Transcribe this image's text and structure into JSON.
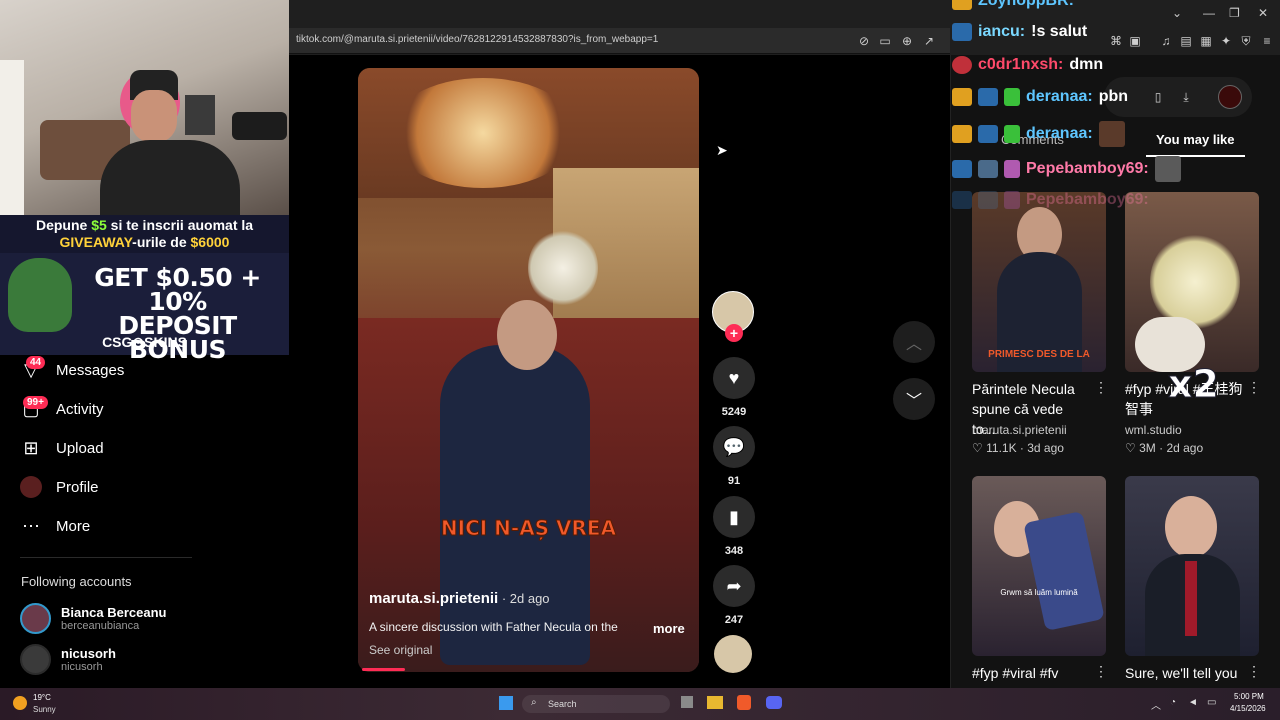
{
  "browser": {
    "url": "tiktok.com/@maruta.si.prietenii/video/7628122914532887830?is_from_webapp=1"
  },
  "promo": {
    "line1_prefix": "Depune ",
    "line1_amount": "$5",
    "line1_suffix": " si te inscrii auomat la",
    "line2_prefix": "GIVEAWAY",
    "line2_mid": "-urile de ",
    "line2_amount": "$6000",
    "bonus_line1": "GET $0.50 + 10%",
    "bonus_line2": "DEPOSIT BONUS",
    "brand": "CSG⊙SKINS"
  },
  "nav": {
    "items": [
      {
        "label": "Messages",
        "badge": "44",
        "icon": "paper-plane-icon"
      },
      {
        "label": "Activity",
        "badge": "99+",
        "icon": "inbox-icon"
      },
      {
        "label": "Upload",
        "icon": "plus-square-icon"
      },
      {
        "label": "Profile",
        "icon": "avatar-icon"
      },
      {
        "label": "More",
        "icon": "ellipsis-icon"
      }
    ],
    "following_title": "Following accounts",
    "following": [
      {
        "name": "Bianca Berceanu",
        "handle": "berceanubianca"
      },
      {
        "name": "nicusorh",
        "handle": "nicusorh"
      }
    ]
  },
  "video": {
    "caption": "NICI N-AȘ VREA",
    "author": "maruta.si.prietenii",
    "age": " · 2d ago",
    "description": "A sincere discussion with Father Necula on the",
    "more": "more",
    "see_original": "See original",
    "progress": 0.13,
    "likes": "5249",
    "comments": "91",
    "saves": "348",
    "shares": "247"
  },
  "right_panel": {
    "tab_comments": "Comments",
    "tab_may_like": "You may like",
    "cards": [
      {
        "title": "Părintele Necula spune că vede to...",
        "author": "maruta.si.prietenii",
        "likes": "11.1K",
        "age": "3d ago",
        "overlay": "PRIMESC DES DE LA"
      },
      {
        "title": "#fyp #viral #王桂狗智事",
        "author": "wml.studio",
        "likes": "3M",
        "age": "2d ago",
        "overlay": "x2"
      },
      {
        "title": "#fyp #viral #fv",
        "author": "",
        "likes": "",
        "age": "",
        "overlay": "Grwm să luăm lumină"
      },
      {
        "title": "Sure, we'll tell you",
        "author": "",
        "likes": "",
        "age": "",
        "overlay": ""
      }
    ]
  },
  "chat": [
    {
      "name": "ZoyhoppBR:",
      "msg": "",
      "color": "#5ec6ff"
    },
    {
      "name": "iancu:",
      "msg": "!s salut",
      "color": "#7ad8ff"
    },
    {
      "name": "c0dr1nxsh:",
      "msg": "dmn",
      "color": "#ff4a6a"
    },
    {
      "name": "deranaa:",
      "msg": "pbn",
      "color": "#5ec6ff"
    },
    {
      "name": "deranaa:",
      "msg": "",
      "color": "#5ec6ff"
    },
    {
      "name": "Pepebamboy69:",
      "msg": "",
      "color": "#ff7aa8"
    },
    {
      "name": "Pepebamboy69:",
      "msg": "",
      "color": "#ff7aa8"
    }
  ],
  "taskbar": {
    "temp": "19°C",
    "condition": "Sunny",
    "search": "Search",
    "time": "5:00 PM",
    "date": "4/15/2026"
  },
  "colors": {
    "accent": "#fe2c55",
    "background": "#000000",
    "panel": "#121212"
  }
}
